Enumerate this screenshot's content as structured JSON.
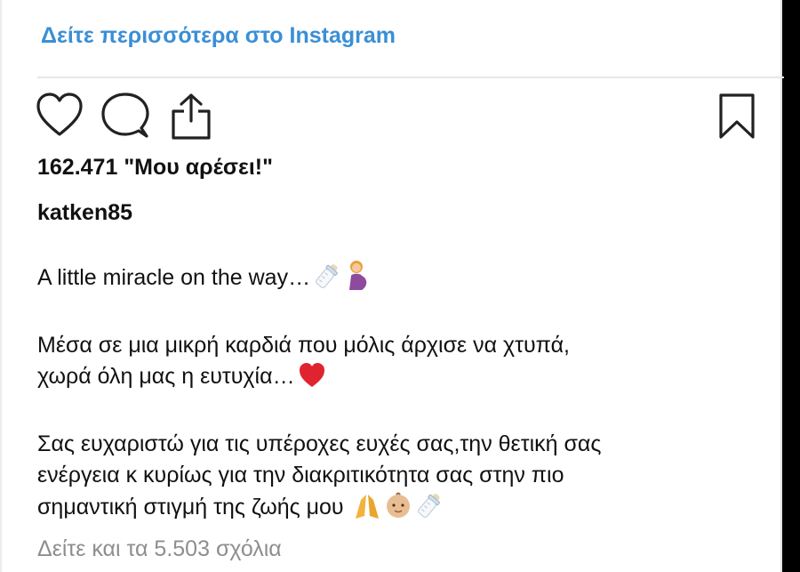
{
  "header": {
    "view_more_link": "Δείτε περισσότερα στο Instagram"
  },
  "actions": {
    "icons": [
      "heart-icon",
      "comment-bubble-icon",
      "share-upload-icon",
      "bookmark-icon"
    ]
  },
  "post": {
    "likes": "162.471 \"Μου αρέσει!\"",
    "username": "katken85",
    "caption": {
      "line1": "A little miracle on the way…",
      "line2": "Μέσα σε μια μικρή καρδιά που μόλις άρχισε να χτυπά,",
      "line3": "χωρά όλη μας η ευτυχία…",
      "line4": "Σας ευχαριστώ για τις υπέροχες ευχές σας,την θετική σας",
      "line5": "ενέργεια κ κυρίως για την διακριτικότητα σας στην πιο",
      "line6": "σημαντική στιγμή της ζωής μου"
    },
    "emojis": [
      "baby-bottle",
      "pregnant-woman",
      "red-heart",
      "folded-hands",
      "baby-face",
      "baby-bottle"
    ],
    "view_comments": "Δείτε και τα 5.503 σχόλια"
  },
  "colors": {
    "link_blue": "#3a8fd6",
    "muted_gray": "#8e8e8e",
    "heart_red": "#e0242f"
  }
}
